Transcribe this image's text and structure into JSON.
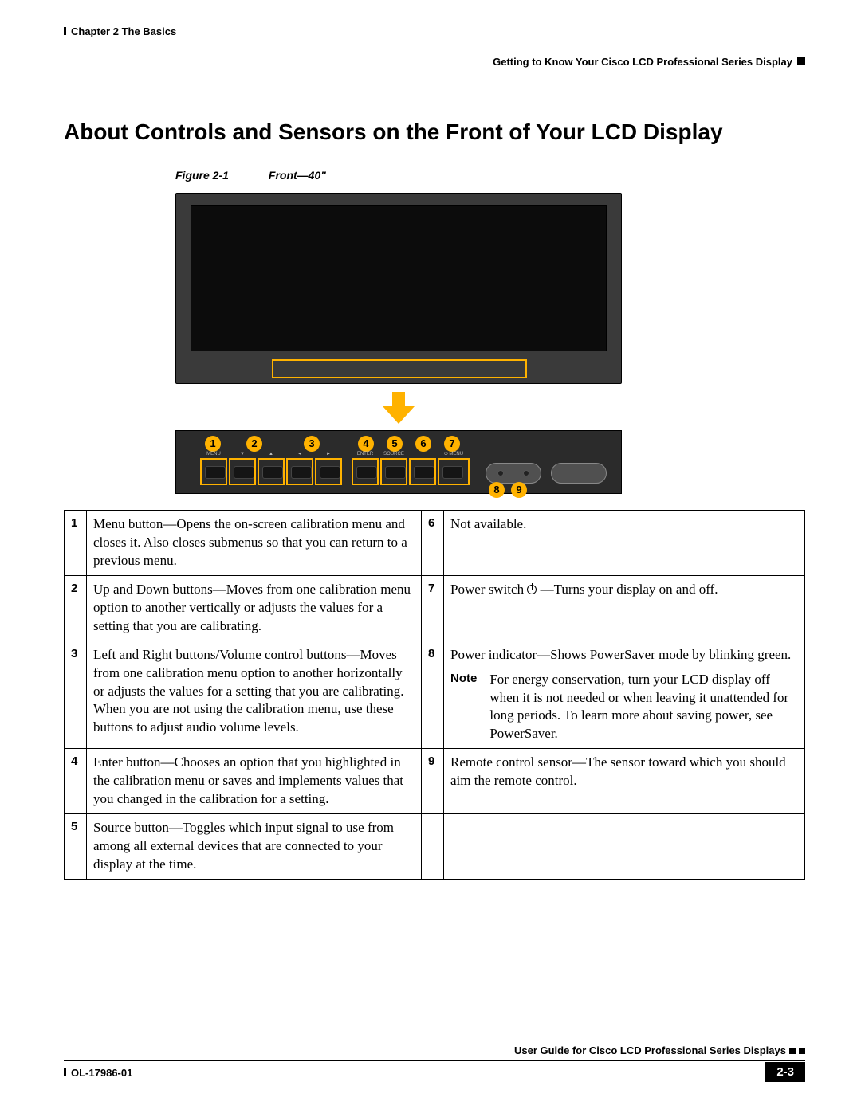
{
  "header": {
    "chapter": "Chapter 2    The Basics",
    "subtitle": "Getting to Know Your Cisco LCD Professional Series Display"
  },
  "title": "About Controls and Sensors on the Front of Your LCD Display",
  "figure": {
    "label": "Figure 2-1",
    "title": "Front—40\"",
    "callouts_top": [
      "1",
      "2",
      "3",
      "4",
      "5",
      "6",
      "7"
    ],
    "callouts_bottom": [
      "8",
      "9"
    ],
    "button_labels": [
      "MENU",
      "▼",
      "▲",
      "◄",
      "►",
      "ENTER",
      "SOURCE",
      "⏻ MENU"
    ]
  },
  "rows": [
    {
      "ln": "1",
      "ld": "Menu button—Opens the on-screen calibration menu and closes it. Also closes submenus so that you can return to a previous menu.",
      "rn": "6",
      "rd": "Not available.",
      "note": null
    },
    {
      "ln": "2",
      "ld": "Up and Down buttons—Moves from one calibration menu option to another vertically or adjusts the values for a setting that you are calibrating.",
      "rn": "7",
      "rd": "Power switch {POWER} —Turns your display on and off.",
      "note": null
    },
    {
      "ln": "3",
      "ld": "Left and Right buttons/Volume control buttons—Moves from one calibration menu option to another horizontally or adjusts the values for a setting that you are calibrating. When you are not using the calibration menu, use these buttons to adjust audio volume levels.",
      "rn": "8",
      "rd": "Power indicator—Shows PowerSaver mode by blinking green.",
      "note": "For energy conservation, turn your LCD display off when it is not needed or when leaving it unattended for long periods. To learn more about saving power, see PowerSaver."
    },
    {
      "ln": "4",
      "ld": "Enter button—Chooses an option that you highlighted in the calibration menu or saves and implements values that you changed in the calibration for a setting.",
      "rn": "9",
      "rd": "Remote control sensor—The sensor toward which you should aim the remote control.",
      "note": null
    },
    {
      "ln": "5",
      "ld": "Source button—Toggles which input signal to use from among all external devices that are connected to your display at the time.",
      "rn": "",
      "rd": "",
      "note": null
    }
  ],
  "note_label": "Note",
  "footer": {
    "guide": "User Guide for Cisco LCD Professional Series Displays",
    "doc": "OL-17986-01",
    "page": "2-3"
  }
}
